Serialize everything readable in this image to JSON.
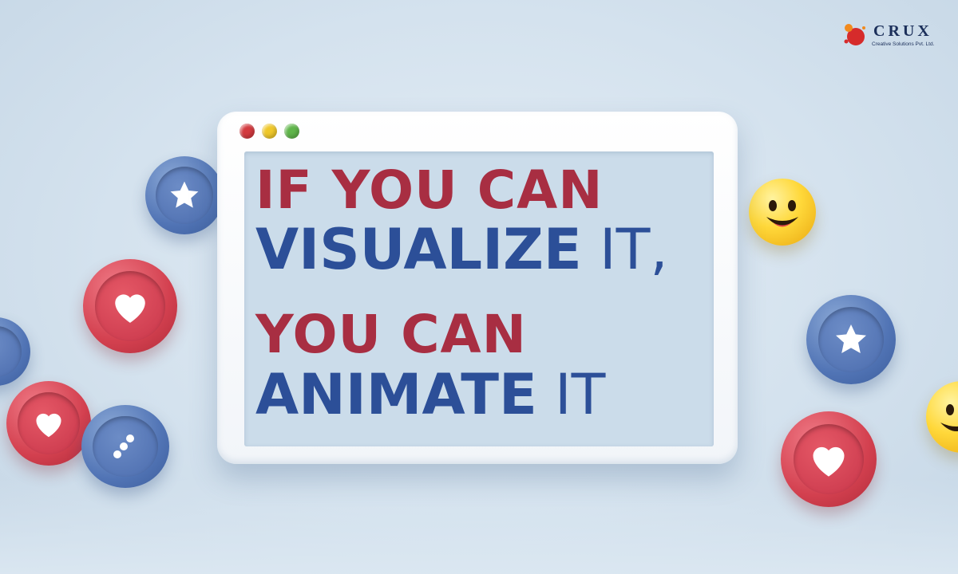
{
  "logo": {
    "name": "CRUX",
    "subtitle": "Creative Solutions Pvt. Ltd."
  },
  "headline": {
    "line1": "IF YOU CAN",
    "line2_bold": "VISUALIZE",
    "line2_rest": " IT,",
    "line3": "YOU CAN",
    "line4_bold": "ANIMATE",
    "line4_rest": " IT"
  },
  "window": {
    "control_dots": [
      "red",
      "yellow",
      "green"
    ]
  },
  "decorations": {
    "icons": [
      "star-badge",
      "heart-badge",
      "heart-badge",
      "chat-bubble",
      "smiley-emoji",
      "star-badge",
      "heart-badge",
      "smiley-emoji"
    ]
  },
  "colors": {
    "headline_red": "#a82e42",
    "headline_blue": "#2c4f98",
    "badge_blue": "#5174b5",
    "badge_red": "#d3404f",
    "emoji_yellow": "#ffd83a",
    "background": "#d4e2ee"
  }
}
